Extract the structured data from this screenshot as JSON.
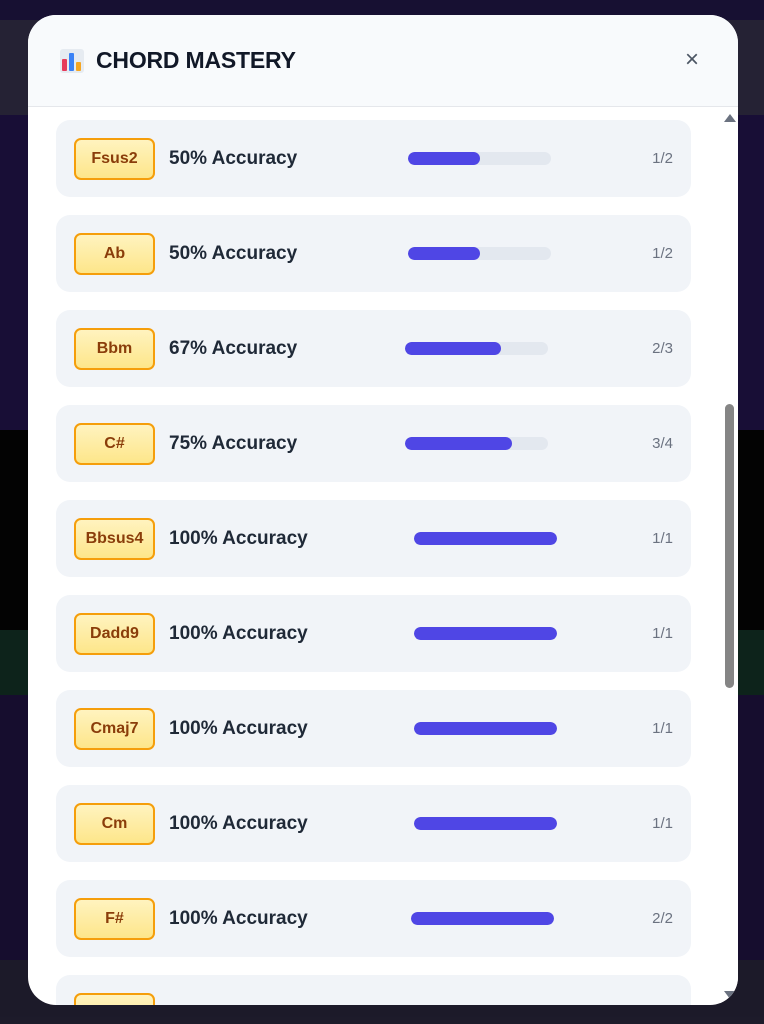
{
  "modal": {
    "title": "CHORD MASTERY",
    "title_icon": "bar-chart-icon",
    "close_label": "×",
    "close_icon": "close-icon"
  },
  "colors": {
    "accent": "#4f46e5",
    "badge_border": "#f59e0b",
    "badge_text": "#8a3d0a",
    "row_bg": "#f1f4f8",
    "track": "#e3e8ef"
  },
  "rows": [
    {
      "chord": "Fsus2",
      "accuracy": "50% Accuracy",
      "progress": 0.5,
      "count": "1/2"
    },
    {
      "chord": "Ab",
      "accuracy": "50% Accuracy",
      "progress": 0.5,
      "count": "1/2"
    },
    {
      "chord": "Bbm",
      "accuracy": "67% Accuracy",
      "progress": 0.67,
      "count": "2/3"
    },
    {
      "chord": "C#",
      "accuracy": "75% Accuracy",
      "progress": 0.75,
      "count": "3/4"
    },
    {
      "chord": "Bbsus4",
      "accuracy": "100% Accuracy",
      "progress": 1.0,
      "count": "1/1"
    },
    {
      "chord": "Dadd9",
      "accuracy": "100% Accuracy",
      "progress": 1.0,
      "count": "1/1"
    },
    {
      "chord": "Cmaj7",
      "accuracy": "100% Accuracy",
      "progress": 1.0,
      "count": "1/1"
    },
    {
      "chord": "Cm",
      "accuracy": "100% Accuracy",
      "progress": 1.0,
      "count": "1/1"
    },
    {
      "chord": "F#",
      "accuracy": "100% Accuracy",
      "progress": 1.0,
      "count": "2/2"
    },
    {
      "chord": "",
      "accuracy": "",
      "progress": 0,
      "count": ""
    }
  ]
}
